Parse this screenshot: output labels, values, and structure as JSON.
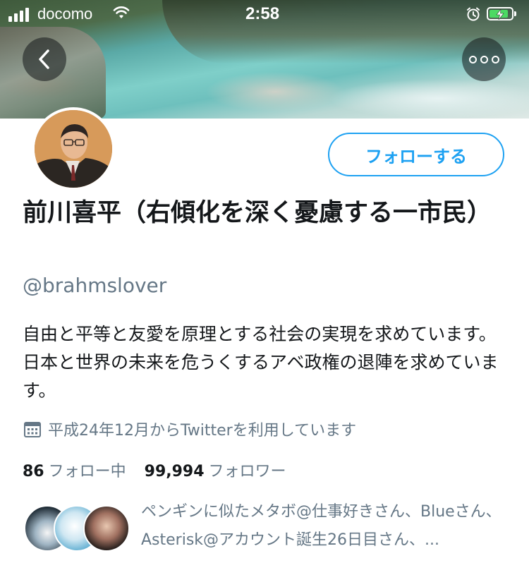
{
  "status_bar": {
    "carrier": "docomo",
    "time": "2:58"
  },
  "header": {
    "banner_colors": [
      "#4e6c4b",
      "#7fcfc9",
      "#dfe9e6"
    ]
  },
  "profile": {
    "follow_button_label": "フォローする",
    "name": "前川喜平（右傾化を深く憂慮する一市民）",
    "handle": "@brahmslover",
    "bio": "自由と平等と友愛を原理とする社会の実現を求めています。 日本と世界の未来を危うくするアベ政権の退陣を求めています。",
    "joined": "平成24年12月からTwitterを利用しています",
    "following_count": "86",
    "following_label": "フォロー中",
    "followers_count": "99,994",
    "followers_label": "フォロワー",
    "followed_by": "ペンギンに似たメタボ@仕事好きさん、Blueさん、Asterisk@アカウント誕生26日目さん、..."
  },
  "colors": {
    "accent": "#1da1f2",
    "secondary_text": "#657786",
    "primary_text": "#14171a",
    "battery": "#4cd964"
  }
}
